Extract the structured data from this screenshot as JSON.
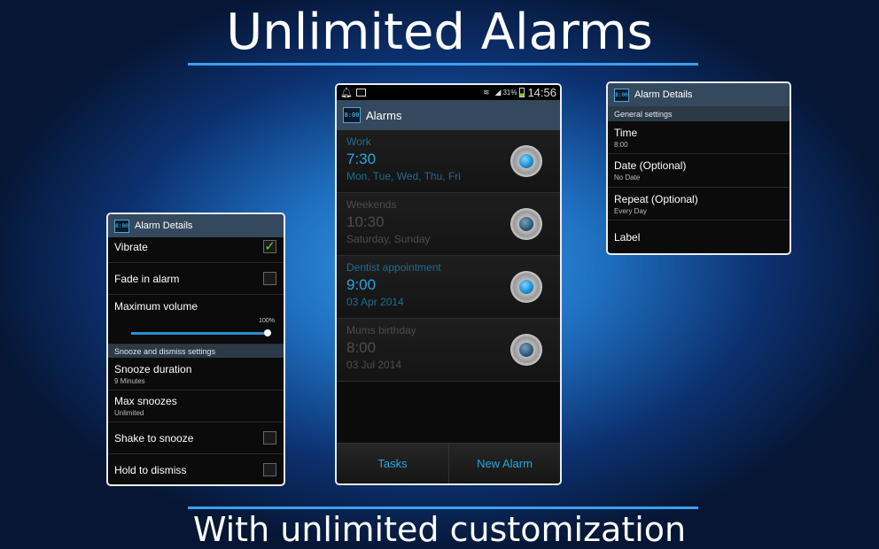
{
  "headline": "Unlimited Alarms",
  "subheadline": "With unlimited customization",
  "colors": {
    "accent": "#25a6e0",
    "action_bar": "#34495e",
    "check": "#6ad02a"
  },
  "phone": {
    "status": {
      "battery": "31%",
      "time": "14:56",
      "icons": [
        "bell-icon",
        "image-icon",
        "wifi-icon",
        "signal-icon",
        "battery-icon"
      ]
    },
    "title": "Alarms",
    "alarms": [
      {
        "name": "Work",
        "time": "7:30",
        "days": "Mon, Tue, Wed, Thu, Fri",
        "enabled": true
      },
      {
        "name": "Weekends",
        "time": "10:30",
        "days": "Saturday, Sunday",
        "enabled": false
      },
      {
        "name": "Dentist appointment",
        "time": "9:00",
        "days": "03 Apr 2014",
        "enabled": true
      },
      {
        "name": "Mums birthday",
        "time": "8:00",
        "days": "03 Jul 2014",
        "enabled": false
      }
    ],
    "tasks_label": "Tasks",
    "new_alarm_label": "New Alarm"
  },
  "left": {
    "title": "Alarm Details",
    "vibrate": {
      "label": "Vibrate",
      "checked": true
    },
    "fade": {
      "label": "Fade in alarm",
      "checked": false
    },
    "volume": {
      "label": "Maximum volume",
      "value": "100%",
      "fraction": 1.0
    },
    "section": "Snooze and dismiss settings",
    "snooze_duration": {
      "label": "Snooze duration",
      "value": "9 Minutes"
    },
    "max_snoozes": {
      "label": "Max snoozes",
      "value": "Unlimited"
    },
    "shake": {
      "label": "Shake to snooze",
      "checked": false
    },
    "hold": {
      "label": "Hold to dismiss",
      "checked": false
    }
  },
  "right": {
    "title": "Alarm Details",
    "section": "General settings",
    "time": {
      "label": "Time",
      "value": "8:00"
    },
    "date": {
      "label": "Date (Optional)",
      "value": "No Date"
    },
    "repeat": {
      "label": "Repeat (Optional)",
      "value": "Every Day"
    },
    "label": {
      "label": "Label"
    }
  },
  "app_icon_text": "8:00"
}
